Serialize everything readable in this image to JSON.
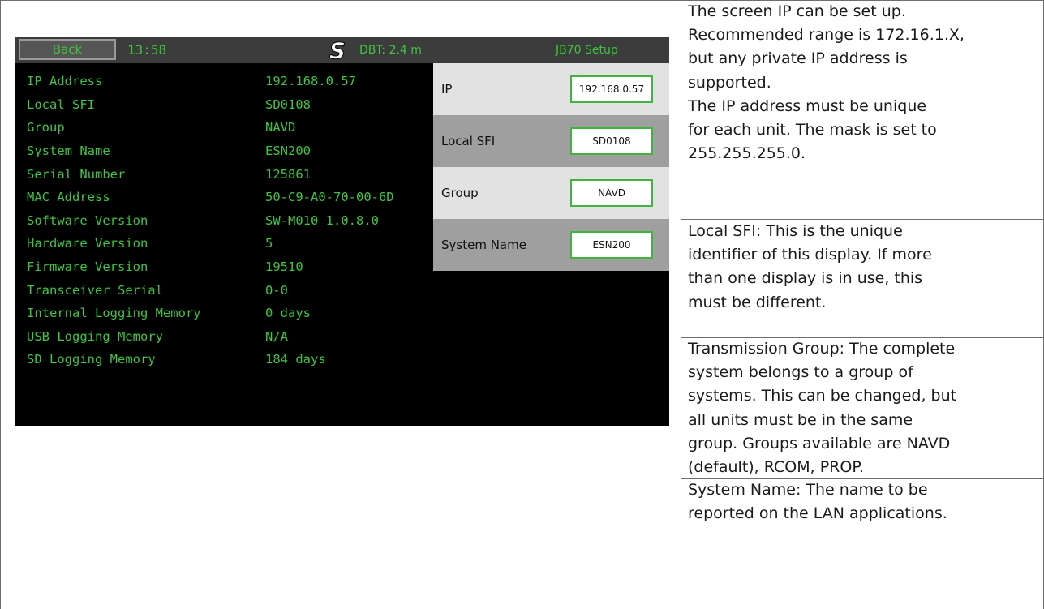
{
  "device": {
    "back_label": "Back",
    "clock": "13:58",
    "logo_icon": "s-logo-icon",
    "dbt": "DBT: 2.4 m",
    "title": "JB70 Setup",
    "accent_color": "#3fc43f",
    "info": [
      {
        "label": "IP Address",
        "value": "192.168.0.57"
      },
      {
        "label": "Local SFI",
        "value": "SD0108"
      },
      {
        "label": "Group",
        "value": "NAVD"
      },
      {
        "label": "System Name",
        "value": "ESN200"
      },
      {
        "label": "Serial Number",
        "value": "125861"
      },
      {
        "label": "MAC Address",
        "value": "50-C9-A0-70-00-6D"
      },
      {
        "label": "Software Version",
        "value": "SW-M010 1.0.8.0"
      },
      {
        "label": "Hardware Version",
        "value": "5"
      },
      {
        "label": "Firmware Version",
        "value": "19510"
      },
      {
        "label": "Transceiver Serial",
        "value": "0-0"
      },
      {
        "label": "Internal Logging Memory",
        "value": "0 days"
      },
      {
        "label": "USB Logging Memory",
        "value": "N/A"
      },
      {
        "label": "SD Logging Memory",
        "value": "184 days"
      }
    ],
    "panel": [
      {
        "label": "IP",
        "value": "192.168.0.57"
      },
      {
        "label": "Local SFI",
        "value": "SD0108"
      },
      {
        "label": "Group",
        "value": "NAVD"
      },
      {
        "label": "System Name",
        "value": "ESN200"
      }
    ]
  },
  "descriptions": [
    [
      "The screen IP can be set up.",
      "Recommended range is 172.16.1.X,",
      "but any private IP address is",
      "supported.",
      "The IP address must be unique",
      "for each unit. The mask is set to",
      "255.255.255.0."
    ],
    [
      "Local SFI: This is  the unique",
      "identifier of this display. If more",
      "than one display is in use, this",
      "must be different."
    ],
    [
      "Transmission Group: The complete",
      "system belongs to a group of",
      "systems. This can be changed, but",
      "all units must be in the same",
      "group. Groups available are NAVD",
      "(default), RCOM, PROP."
    ],
    [
      "System Name: The name to be",
      "reported on the LAN applications."
    ]
  ]
}
